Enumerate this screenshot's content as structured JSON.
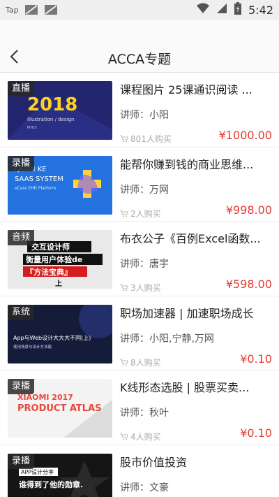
{
  "status_bar": {
    "left_label": "Tap",
    "time": "5:42",
    "icons": [
      "image-icon",
      "image-icon",
      "wifi-icon",
      "signal-icon",
      "battery-charging-icon"
    ]
  },
  "header": {
    "title": "ACCA专题",
    "back_icon": "chevron-left-icon"
  },
  "labels": {
    "teacher_prefix": "讲师：",
    "buyers_icon": "cart-icon"
  },
  "colors": {
    "price": "#e43b32",
    "tag_bg": "#333333"
  },
  "courses": [
    {
      "tag": "直播",
      "title": "课程图片 25课通识阅读 ...",
      "teacher": "小阳",
      "buyers": "801人购买",
      "price": "¥1000.00",
      "thumb_text": [
        "2018",
        "Illustration / design",
        "PHUS"
      ]
    },
    {
      "tag": "录播",
      "title": "能帮你赚到钱的商业思维...",
      "teacher": "万网",
      "buyers": "2人购买",
      "price": "¥998.00",
      "thumb_text": [
        "QUAN KE",
        "SAAS SYSTEM",
        "eCare EHR Platform"
      ]
    },
    {
      "tag": "音频",
      "title": "布衣公子《百例Excel函数...",
      "teacher": "唐宇",
      "buyers": "3人购买",
      "price": "¥598.00",
      "thumb_text": [
        "交互设计师",
        "衡量用户体验de",
        "『方法宝典』",
        "上"
      ]
    },
    {
      "tag": "系统",
      "title": "职场加速器 | 加速职场成长",
      "teacher": "小阳,宁静,万网",
      "buyers": "8人购买",
      "price": "¥0.10",
      "thumb_text": [
        "App与Web设计大大大不同(上)",
        "使用场景与设计方法篇"
      ]
    },
    {
      "tag": "录播",
      "title": "K线形态选股 | 股票买卖...",
      "teacher": "秋叶",
      "buyers": "4人购买",
      "price": "¥0.10",
      "thumb_text": [
        "XIAOMI 2017",
        "PRODUCT ATLAS"
      ]
    },
    {
      "tag": "录播",
      "title": "股市价值投资",
      "teacher": "文豪",
      "buyers": "",
      "price": "",
      "thumb_text": [
        "APP设计分享",
        "谁得到了他的勋章."
      ]
    }
  ]
}
